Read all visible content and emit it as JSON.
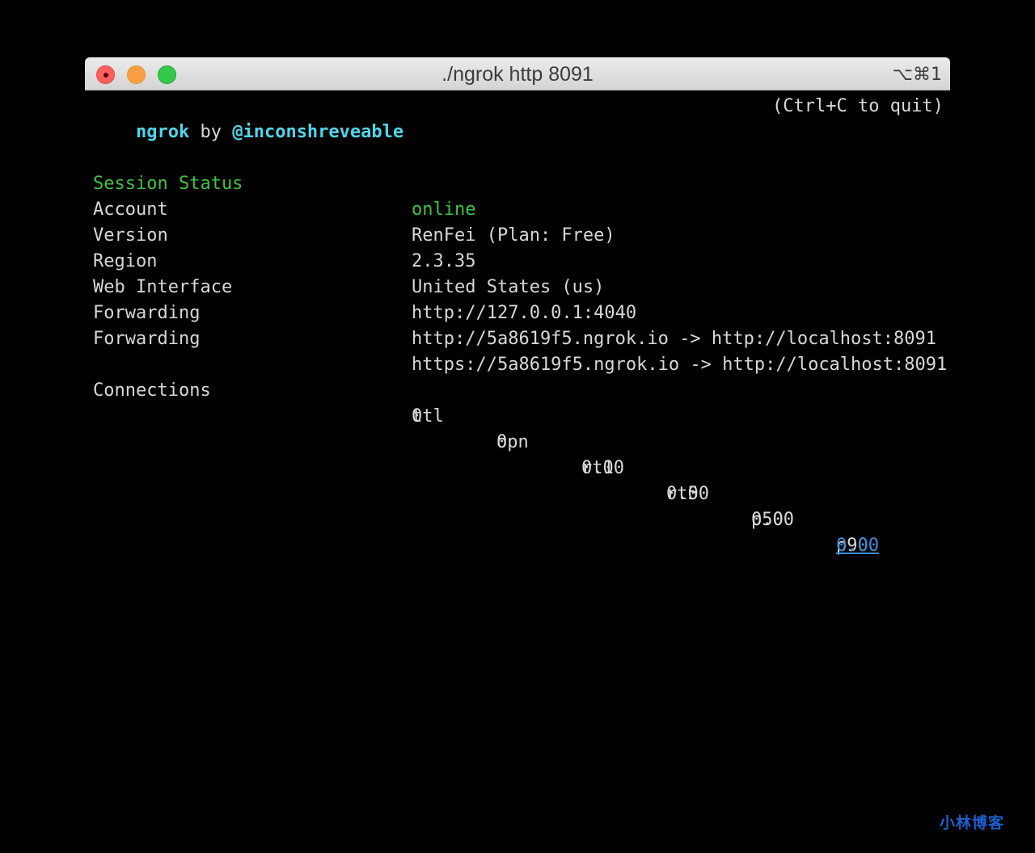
{
  "window": {
    "title": "./ngrok http 8091",
    "shortcut": "⌥⌘1"
  },
  "header": {
    "app": "ngrok",
    "by": "by",
    "author": "@inconshreveable",
    "quit_hint": "(Ctrl+C to quit)"
  },
  "status": [
    {
      "label": "Session Status",
      "value": "online"
    },
    {
      "label": "Account",
      "value": "RenFei (Plan: Free)"
    },
    {
      "label": "Version",
      "value": "2.3.35"
    },
    {
      "label": "Region",
      "value": "United States (us)"
    },
    {
      "label": "Web Interface",
      "value": "http://127.0.0.1:4040"
    },
    {
      "label": "Forwarding",
      "value": "http://5a8619f5.ngrok.io -> http://localhost:8091"
    },
    {
      "label": "Forwarding",
      "value": "https://5a8619f5.ngrok.io -> http://localhost:8091"
    }
  ],
  "connections": {
    "label": "Connections",
    "headers": [
      "ttl",
      "opn",
      "rt1",
      "rt5",
      "p50",
      "p90"
    ],
    "values": [
      "0",
      "0",
      "0.00",
      "0.00",
      "0.00",
      "0.00"
    ]
  },
  "colors": {
    "cyan": "#4fd6ea",
    "green": "#3ec43e",
    "text": "#d7d7d7",
    "link": "#3a8fd6"
  },
  "watermark": "小林博客"
}
